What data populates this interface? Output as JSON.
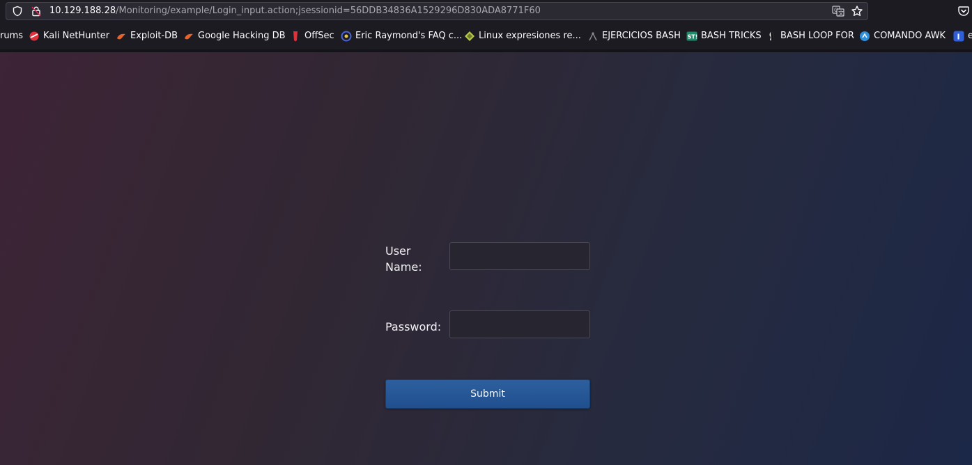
{
  "browser": {
    "url": {
      "host": "10.129.188.28",
      "path": "/Monitoring/example/Login_input.action;jsessionid=56DDB34836A1529296D830ADA8771F60"
    },
    "icons": {
      "tracking_protection": "shield-icon",
      "security": "insecure-lock-icon",
      "translate": "translate-icon",
      "bookmark": "star-icon",
      "pocket": "pocket-icon"
    },
    "bookmarks": [
      {
        "label": "rums",
        "icon": ""
      },
      {
        "label": "Kali NetHunter",
        "icon": "kali-nethunter-icon",
        "color": "#e0303a"
      },
      {
        "label": "Exploit-DB",
        "icon": "exploit-db-icon",
        "color": "#e8632a"
      },
      {
        "label": "Google Hacking DB",
        "icon": "ghdb-icon",
        "color": "#e8632a"
      },
      {
        "label": "OffSec",
        "icon": "offsec-icon",
        "color": "#e0303a"
      },
      {
        "label": "Eric Raymond's FAQ c...",
        "icon": "catb-icon",
        "color": "#4a63d8"
      },
      {
        "label": "Linux expresiones re...",
        "icon": "diamond-icon",
        "color": "#b8c94a"
      },
      {
        "label": "EJERCICIOS BASH",
        "icon": "antenna-icon",
        "color": "#8a8a92"
      },
      {
        "label": "BASH TRICKS",
        "icon": "st-icon",
        "color": "#1f8a6a"
      },
      {
        "label": "BASH LOOP FOR",
        "icon": "figure-icon",
        "color": "#e8e8ea"
      },
      {
        "label": "COMANDO AWK",
        "icon": "circle-logo-icon",
        "color": "#2f8fd8"
      },
      {
        "label": "e",
        "icon": "letter-i-icon",
        "color": "#2f5fd8"
      }
    ]
  },
  "login_form": {
    "username_label": "User Name:",
    "password_label": "Password:",
    "username_value": "",
    "password_value": "",
    "submit_label": "Submit"
  }
}
